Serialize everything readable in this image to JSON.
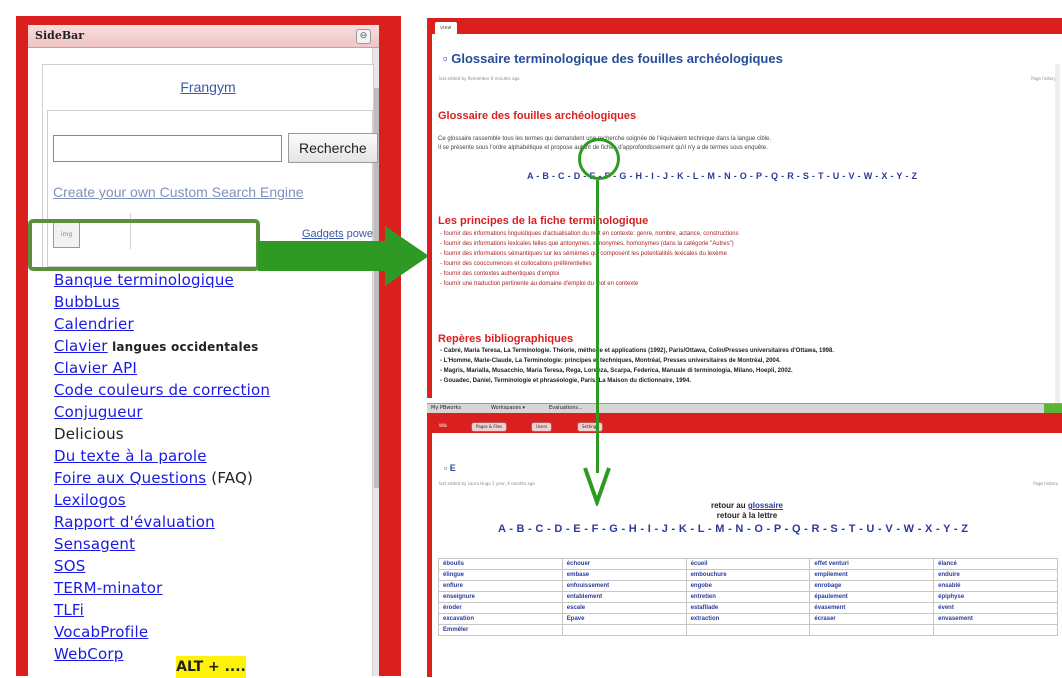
{
  "sidebar": {
    "title": "SideBar",
    "collapse_icon": "⊖",
    "frangym_link": "Frangym",
    "search_button": "Recherche",
    "cse_link": "Create your own Custom Search Engine",
    "gadget_icon_text": "img",
    "gadgets_link": "Gadgets",
    "gadgets_suffix": " powe",
    "links": [
      {
        "label": "Banque terminologique",
        "kind": "link"
      },
      {
        "label": "BubbLus",
        "kind": "link"
      },
      {
        "label": "Calendrier",
        "kind": "link"
      },
      {
        "label": "Clavier",
        "kind": "link",
        "suffix": " langues occidentales"
      },
      {
        "label": "Clavier API",
        "kind": "link"
      },
      {
        "label": "Code couleurs de correction",
        "kind": "link"
      },
      {
        "label": "Conjugueur",
        "kind": "link"
      },
      {
        "label": "Delicious",
        "kind": "plain"
      },
      {
        "label": "Du texte à la parole",
        "kind": "link"
      },
      {
        "label": "Foire aux Questions",
        "kind": "link",
        "faq": " (FAQ)"
      },
      {
        "label": "Lexilogos",
        "kind": "link"
      },
      {
        "label": "Rapport d'évaluation",
        "kind": "link"
      },
      {
        "label": "Sensagent",
        "kind": "link"
      },
      {
        "label": "SOS",
        "kind": "link"
      },
      {
        "label": "TERM-minator",
        "kind": "link"
      },
      {
        "label": "TLFi",
        "kind": "link"
      },
      {
        "label": "VocabProfile",
        "kind": "link"
      },
      {
        "label": "WebCorp",
        "kind": "link"
      }
    ],
    "shortcut_badge": "ALT + ...."
  },
  "top_window": {
    "tab_view": "view",
    "page_title": "Glossaire terminologique des fouilles archéologiques",
    "page_meta": "last edited by Remember 6 minutes ago",
    "page_history": "Page history",
    "section1_heading": "Glossaire des fouilles archéologiques",
    "intro_line1": "Ce glossaire rassemble tous les termes qui demandent une recherche soignée de l'équivalent technique dans la langue cible.",
    "intro_line2": "Il se présente sous l'ordre alphabétique et propose autant de fiches d'approfondissement qu'il n'y a de termes sous enquête.",
    "alphabet": "A - B - C - D - E - F - G - H - I - J - K - L - M - N - O - P - Q - R - S - T - U - V - W - X - Y - Z",
    "section2_heading": "Les principes de la fiche terminologique",
    "principles": [
      "- fournir des informations linguistiques d'actualisation du mot en contexte: genre, nombre, actance, constructions",
      "- fournir des informations lexicales telles que antonymes, synonymes, homonymes (dans la catégorie \"Autres\")",
      "- fournir des informations sémantiques sur les sémèmes qui composent les potentialités lexicales du lexème",
      "- fournir des cooccurrences et collocations préférentielles",
      "- fournir des contextes authentiques d'emploi",
      "- fournir une traduction pertinente au domaine d'emploi du mot en contexte"
    ],
    "section3_heading": "Repères bibliographiques",
    "biblio": [
      "- Cabré, Maria Teresa, La Terminologie. Théorie, méthode et applications (1992), Paris/Ottawa, Colin/Presses universitaires d'Ottawa, 1998.",
      "- L'Homme, Marie-Claude, La Terminologie: principes et techniques, Montréal, Presses universitaires de Montréal, 2004.",
      "- Magris, Marialla, Musacchio, Maria Teresa, Rega, Lorenza, Scarpa, Federica, Manuale di terminologia, Milano, Hoepli, 2002.",
      "- Gouadec, Daniel, Terminologie et phraséologie, Paris, La Maison du dictionnaire, 1994."
    ]
  },
  "mid_bar": {
    "tabs": [
      "My PBworks",
      "Workspaces ▾",
      "Evaluations..."
    ]
  },
  "bottom_window": {
    "toolbar": [
      "Wiki",
      "Pages & Files",
      "Users",
      "Settings"
    ],
    "tab_view": "view",
    "page_title": "E",
    "page_meta": "last edited by Laura Hugo 1 year, 4 months ago",
    "page_history": "Page history",
    "retour_prefix": "retour au ",
    "retour_link": "glossaire",
    "retour_letter": "retour à la lettre",
    "alphabet": "A - B - C - D - E - F - G - H - I - J - K - L - M - N - O - P - Q - R - S - T - U - V - W - X - Y - Z",
    "table": [
      [
        "éboulis",
        "échouer",
        "écueil",
        "effet venturi",
        "élancé"
      ],
      [
        "élingue",
        "embase",
        "embouchure",
        "empilement",
        "enduire"
      ],
      [
        "enflure",
        "enfouissement",
        "engobe",
        "enrobage",
        "ensablé"
      ],
      [
        "enseignure",
        "entablement",
        "entretien",
        "épaulement",
        "épiphyse"
      ],
      [
        "éroder",
        "escale",
        "estafilade",
        "évasement",
        "évent"
      ],
      [
        "excavation",
        "Epave",
        "extraction",
        "écraser",
        "envasement"
      ],
      [
        "Emmêler",
        "",
        "",
        "",
        ""
      ]
    ]
  },
  "colors": {
    "frame_red": "#d9201f",
    "highlight_green": "#2f9a23",
    "link_blue": "#1a1ae6",
    "badge_yellow": "#fff20a"
  }
}
